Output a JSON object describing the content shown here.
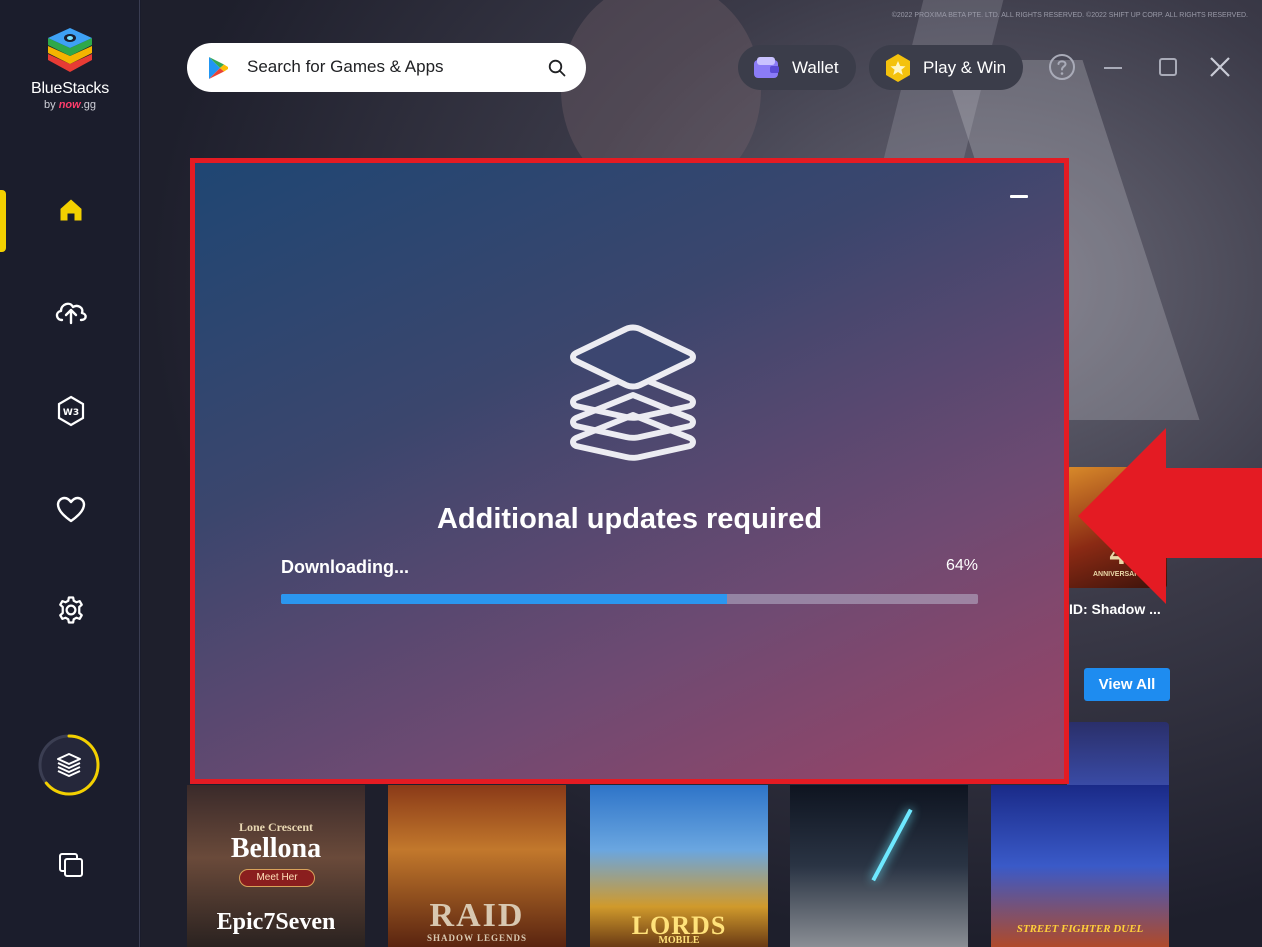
{
  "app": {
    "logo_name": "BlueStacks",
    "logo_by": "by",
    "logo_brand": "now",
    "logo_domain": ".gg"
  },
  "search": {
    "placeholder": "Search for Games & Apps"
  },
  "topbar": {
    "wallet_label": "Wallet",
    "play_label": "Play & Win"
  },
  "hero": {
    "copyright": "©2022 PROXIMA BETA PTE. LTD. ALL RIGHTS RESERVED. ©2022 SHIFT UP CORP. ALL RIGHTS RESERVED."
  },
  "sidebar": {
    "items": [
      {
        "name": "home",
        "icon": "home-icon"
      },
      {
        "name": "cloud-upload",
        "icon": "cloud-upload-icon"
      },
      {
        "name": "web3",
        "icon": "w3-icon",
        "label": "W3"
      },
      {
        "name": "favorites",
        "icon": "heart-icon"
      },
      {
        "name": "settings",
        "icon": "gear-icon"
      },
      {
        "name": "layers",
        "icon": "layers-icon"
      },
      {
        "name": "multi-instance",
        "icon": "multi-instance-icon"
      }
    ],
    "accent": "#f3d000"
  },
  "content": {
    "view_all_label": "View All",
    "raid_label": "ID: Shadow ...",
    "raid_badge": "4",
    "raid_badge_sub": "ANNIVERSARY",
    "tiles": [
      {
        "subtitle": "Lone Crescent",
        "title": "Bellona",
        "button": "Meet Her",
        "footer": "Epic7Seven"
      },
      {
        "title": "RAID",
        "footer": "SHADOW LEGENDS"
      },
      {
        "title": "LORDS",
        "footer": "MOBILE"
      },
      {
        "title": ""
      },
      {
        "title": "STREET FIGHTER DUEL"
      }
    ]
  },
  "dialog": {
    "title": "Additional updates required",
    "status": "Downloading...",
    "percent_label": "64%",
    "progress": 0.64,
    "border_color": "#e41b23",
    "bar_color": "#2b96ef"
  }
}
